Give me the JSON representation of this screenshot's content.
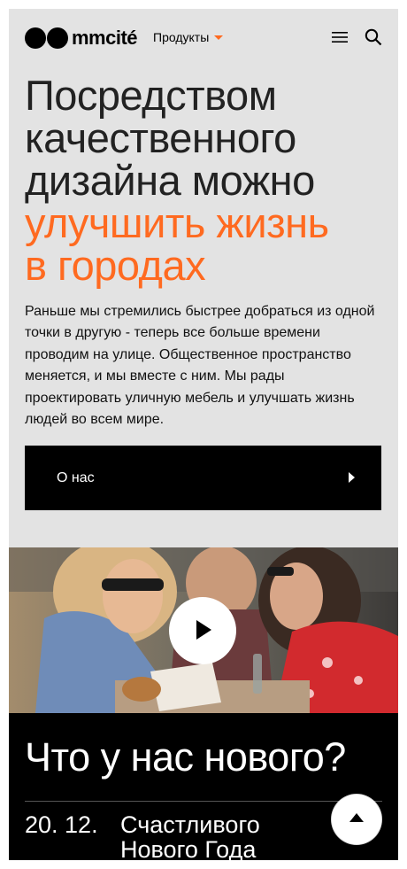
{
  "header": {
    "brand": "mmcité",
    "products_label": "Продукты",
    "menu_icon": "hamburger-icon",
    "search_icon": "search-icon"
  },
  "hero": {
    "headline_lines": [
      "Посредством",
      "качественного",
      "дизайна можно"
    ],
    "headline_accent_lines": [
      "улучшить жизнь",
      "в городах"
    ],
    "intro": "Раньше мы стремились быстрее добраться из одной точки в другую - теперь все больше времени проводим на улице. Общественное пространство меняется, и мы вместе с ним. Мы рады проектировать уличную мебель и улучшать жизнь людей во всем мире.",
    "about_button_label": "О нас"
  },
  "video": {
    "play_icon": "play-icon"
  },
  "news": {
    "title": "Что у нас нового?",
    "items": [
      {
        "date": "20. 12.",
        "text": "Счастливого Нового Года"
      }
    ]
  },
  "colors": {
    "accent": "#ff6a20",
    "background": "#e3e3e3",
    "dark": "#000000"
  }
}
